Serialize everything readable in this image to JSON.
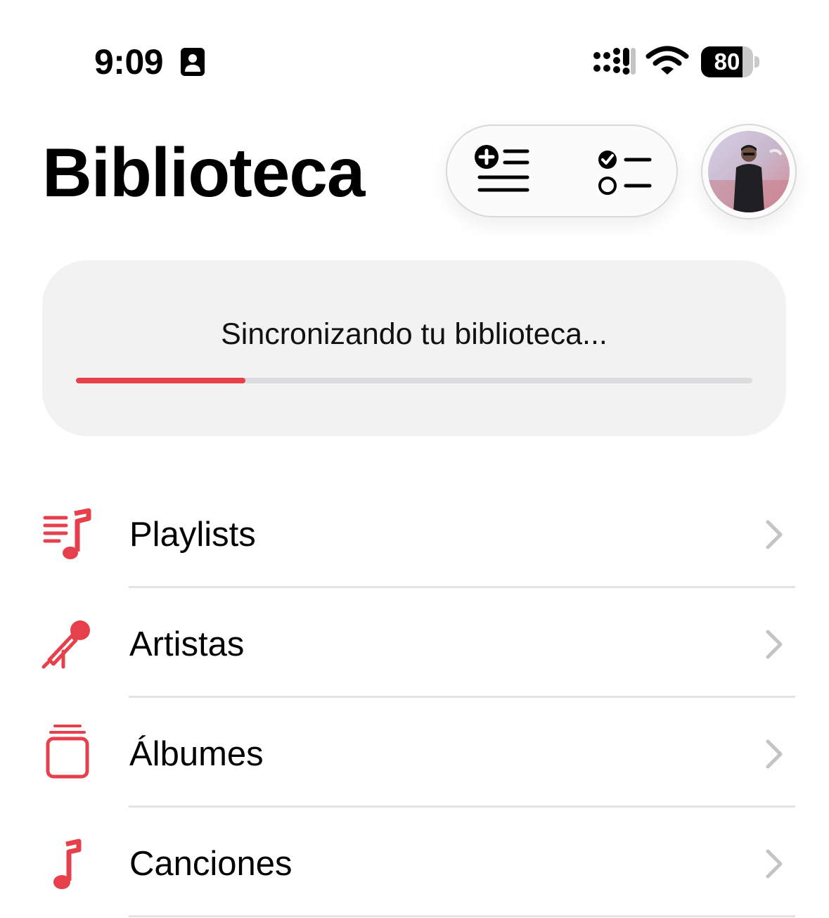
{
  "status_bar": {
    "time": "9:09",
    "battery_level": "80",
    "battery_fraction": 0.8,
    "icons": [
      "focus-person-icon",
      "cellular-signal-icon",
      "wifi-icon",
      "battery-icon"
    ]
  },
  "header": {
    "title": "Biblioteca",
    "toolbar": {
      "add_icon": "add-to-list-icon",
      "select_icon": "checklist-icon"
    },
    "avatar": "profile-avatar"
  },
  "sync": {
    "message": "Sincronizando tu biblioteca...",
    "progress_fraction": 0.25,
    "accent_color": "#e5404b"
  },
  "library_items": [
    {
      "label": "Playlists",
      "icon": "playlist-icon"
    },
    {
      "label": "Artistas",
      "icon": "microphone-icon"
    },
    {
      "label": "Álbumes",
      "icon": "album-stack-icon"
    },
    {
      "label": "Canciones",
      "icon": "music-note-icon"
    }
  ],
  "colors": {
    "accent": "#e5404b",
    "card_background": "#f2f2f3",
    "chevron": "#c4c4c7"
  }
}
